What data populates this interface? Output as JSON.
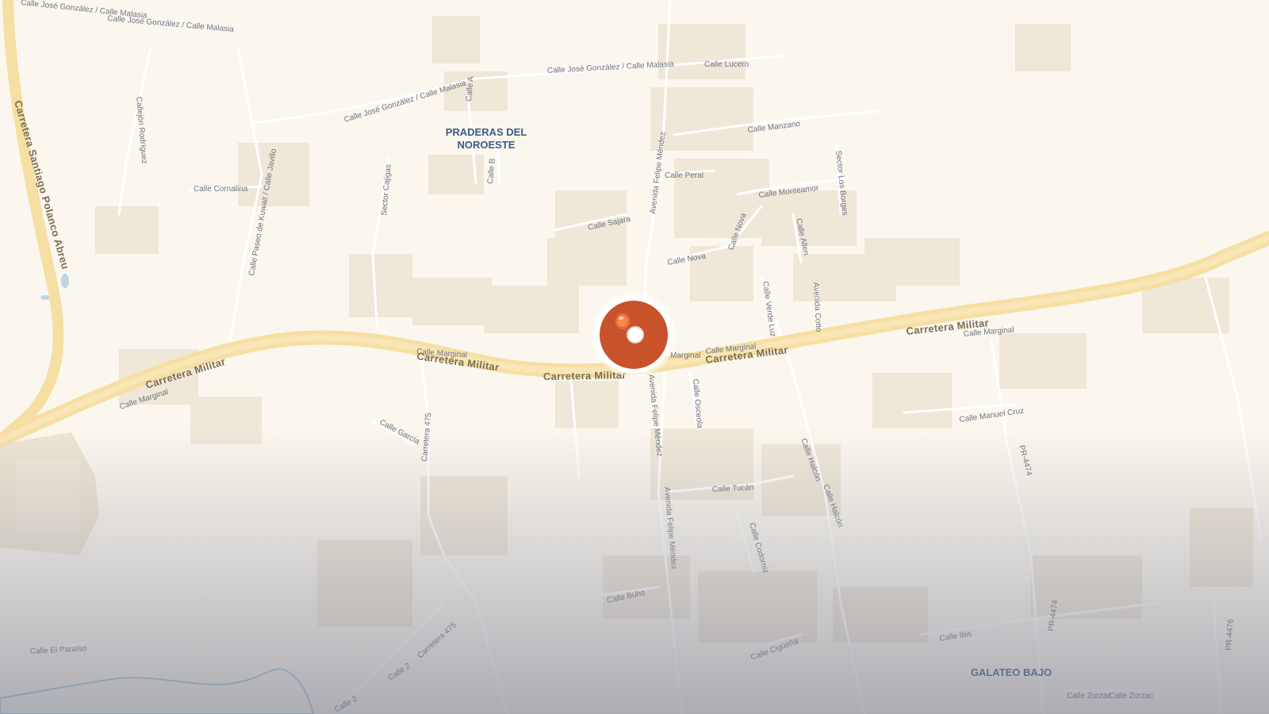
{
  "map": {
    "neighborhoods": [
      "PRADERAS DEL",
      "NOROESTE",
      "GALATEO BAJO"
    ],
    "highways": [
      "Carretera Militar",
      "Carretera Militar",
      "Carretera Militar",
      "Carretera Militar",
      "Carretera Santiago Polanco Abreu"
    ],
    "streets": [
      "Calle José González / Calle Malasia",
      "Calle José González / Calle Malasia",
      "Calle José González / Calle Malasia",
      "Calle Lucero",
      "Callejón Rodríguez",
      "Calle A",
      "Calle B",
      "Calle Cornalina",
      "Calle Paseo de Kuwait / Calle Javillo",
      "Sector Cajigas",
      "Avenida Felipe Méndez",
      "Avenida Felipe Méndez",
      "Avenida Felipe Méndez",
      "Calle Manzano",
      "Calle Peral",
      "Calle Monteamor",
      "Sector Los Borges",
      "Calle Sajara",
      "Calle Nova",
      "Calle Nova",
      "Calle Allen",
      "Calle Verde Luz",
      "Avenida Cotto",
      "Calle Marginal",
      "Calle Marginal",
      "Calle Marginal",
      "Calle Marginal",
      "Marginal",
      "Calle Osceola",
      "Calle García",
      "Carretera 475",
      "Carretera 475",
      "Calle Halcón",
      "Calle Halcón",
      "Calle Tucán",
      "Calle Manuel Cruz",
      "PR-4474",
      "PR-4474",
      "Calle Codorniz",
      "Calle Buho",
      "Calle Cigüeña",
      "Calle Ibis",
      "Calle El Paraíso",
      "Calle 2",
      "Calle 2",
      "Calle Zorzac",
      "Calle Zorzac",
      "PR-4476"
    ]
  },
  "marker": {
    "icon": "location-pin-icon",
    "color": "#c8522a"
  },
  "colors": {
    "background": "#fbf7ee",
    "highway": "#f6dfa3",
    "road": "#ffffff",
    "building": "#efe7d8",
    "neighborhood_label": "#3d5a86"
  }
}
